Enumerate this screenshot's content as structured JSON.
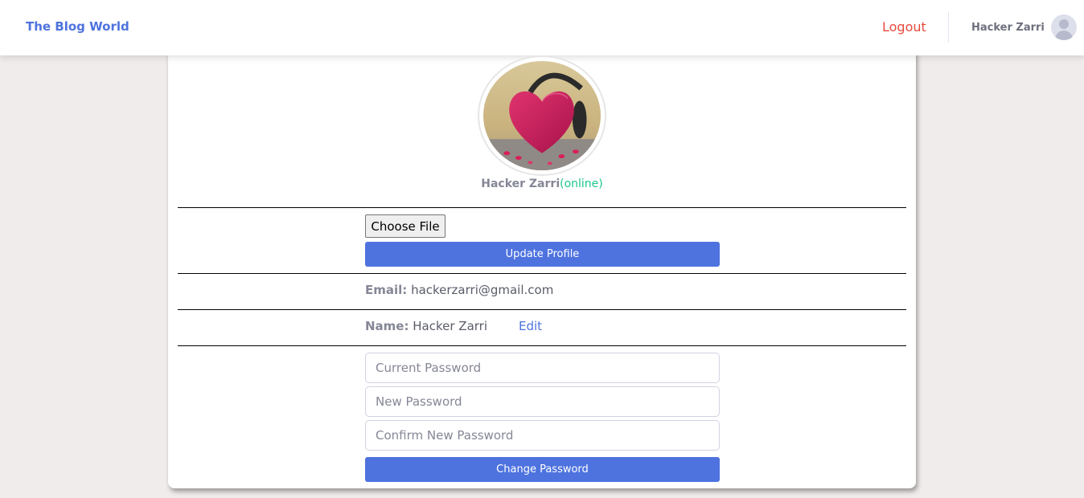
{
  "header": {
    "brand": "The Blog World",
    "logout_label": "Logout",
    "user_name": "Hacker Zarri"
  },
  "profile": {
    "name": "Hacker Zarri",
    "status": "(online)",
    "choose_file_label": "Choose File",
    "update_button_label": "Update Profile"
  },
  "details": {
    "email_label": "Email:",
    "email_value": "hackerzarri@gmail.com",
    "name_label": "Name:",
    "name_value": "Hacker Zarri",
    "edit_label": "Edit"
  },
  "password_form": {
    "current_placeholder": "Current Password",
    "new_placeholder": "New Password",
    "confirm_placeholder": "Confirm New Password",
    "submit_label": "Change Password"
  },
  "colors": {
    "primary": "#4e73df",
    "danger": "#e74a3b",
    "success": "#1cc88a",
    "background": "#f0ecec"
  }
}
